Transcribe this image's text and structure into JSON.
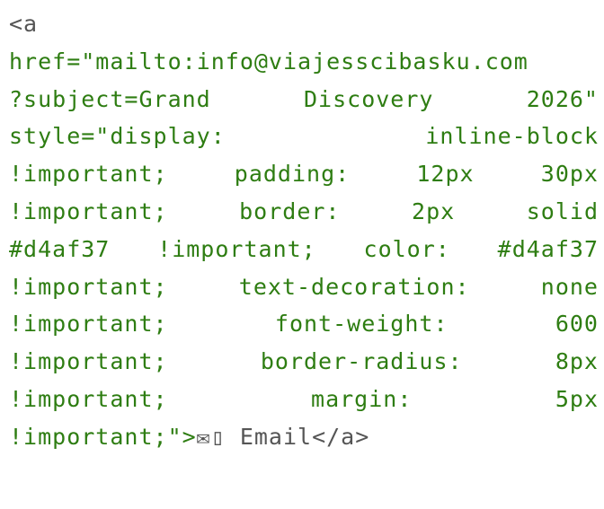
{
  "code": {
    "lines": [
      [
        {
          "t": "<a",
          "c": "tag"
        }
      ],
      [
        {
          "t": "href=\"mailto:info@viajesscibasku.com",
          "c": "attr"
        }
      ],
      [
        {
          "t": "?subject=Grand",
          "c": "attr"
        },
        {
          "t": "Discovery",
          "c": "attr"
        },
        {
          "t": "2026\"",
          "c": "attr"
        }
      ],
      [
        {
          "t": "style=\"display:",
          "c": "attr"
        },
        {
          "t": "inline-block",
          "c": "attr"
        }
      ],
      [
        {
          "t": "!important;",
          "c": "attr"
        },
        {
          "t": "padding:",
          "c": "attr"
        },
        {
          "t": "12px",
          "c": "attr"
        },
        {
          "t": "30px",
          "c": "attr"
        }
      ],
      [
        {
          "t": "!important;",
          "c": "attr"
        },
        {
          "t": "border:",
          "c": "attr"
        },
        {
          "t": "2px",
          "c": "attr"
        },
        {
          "t": "solid",
          "c": "attr"
        }
      ],
      [
        {
          "t": "#d4af37",
          "c": "attr"
        },
        {
          "t": "!important;",
          "c": "attr"
        },
        {
          "t": "color:",
          "c": "attr"
        },
        {
          "t": "#d4af37",
          "c": "attr"
        }
      ],
      [
        {
          "t": "!important;",
          "c": "attr"
        },
        {
          "t": "text-decoration:",
          "c": "attr"
        },
        {
          "t": "none",
          "c": "attr"
        }
      ],
      [
        {
          "t": "!important;",
          "c": "attr"
        },
        {
          "t": "font-weight:",
          "c": "attr"
        },
        {
          "t": "600",
          "c": "attr"
        }
      ],
      [
        {
          "t": "!important;",
          "c": "attr"
        },
        {
          "t": "border-radius:",
          "c": "attr"
        },
        {
          "t": "8px",
          "c": "attr"
        }
      ],
      [
        {
          "t": "!important;",
          "c": "attr"
        },
        {
          "t": "margin:",
          "c": "attr"
        },
        {
          "t": "5px",
          "c": "attr"
        }
      ],
      [
        {
          "t": "!important;\">",
          "c": "attr"
        },
        {
          "t": "✉▯ Email</a>",
          "c": "text"
        }
      ]
    ]
  },
  "colors": {
    "attribute_green": "#2e7d12",
    "tag_gray": "#555555",
    "background": "#ffffff"
  }
}
